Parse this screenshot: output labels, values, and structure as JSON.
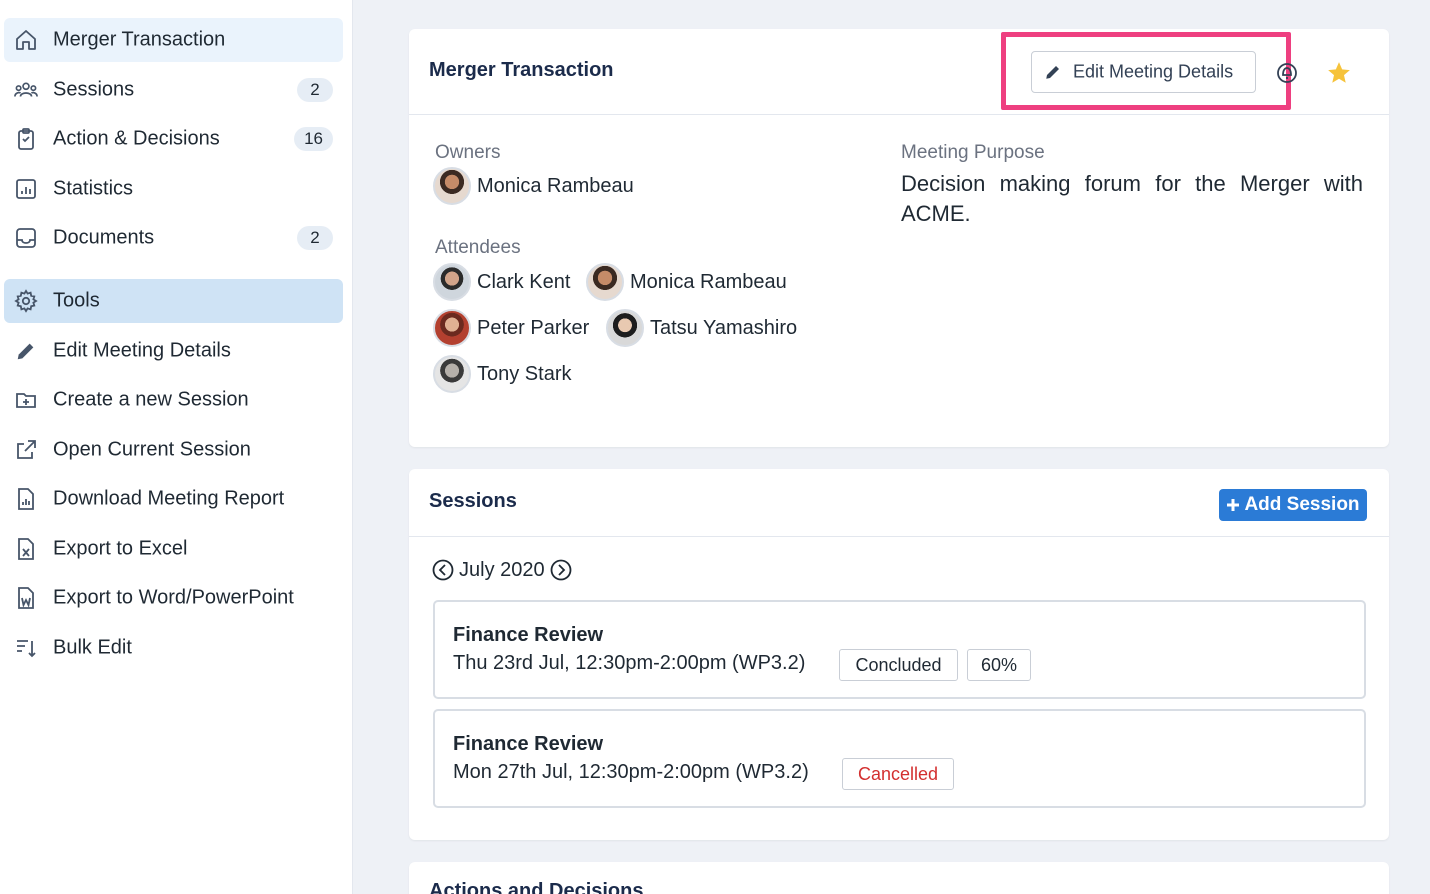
{
  "sidebar": {
    "items": [
      {
        "label": "Merger Transaction",
        "icon": "home-icon"
      },
      {
        "label": "Sessions",
        "badge": "2",
        "icon": "people-icon"
      },
      {
        "label": "Action & Decisions",
        "badge": "16",
        "icon": "clipboard-icon"
      },
      {
        "label": "Statistics",
        "icon": "bar-chart-icon"
      },
      {
        "label": "Documents",
        "badge": "2",
        "icon": "inbox-icon"
      }
    ],
    "tools_label": "Tools",
    "tools": [
      {
        "label": "Edit Meeting Details",
        "icon": "pencil-icon"
      },
      {
        "label": "Create a new Session",
        "icon": "folder-plus-icon"
      },
      {
        "label": "Open Current Session",
        "icon": "external-link-icon"
      },
      {
        "label": "Download Meeting Report",
        "icon": "report-icon"
      },
      {
        "label": "Export to Excel",
        "icon": "excel-file-icon"
      },
      {
        "label": "Export to Word/PowerPoint",
        "icon": "word-file-icon"
      },
      {
        "label": "Bulk Edit",
        "icon": "sort-list-icon"
      }
    ]
  },
  "meeting": {
    "title": "Merger Transaction",
    "edit_button": "Edit Meeting Details",
    "owners_label": "Owners",
    "owners": [
      "Monica Rambeau"
    ],
    "attendees_label": "Attendees",
    "attendees": [
      "Clark Kent",
      "Monica Rambeau",
      "Peter Parker",
      "Tatsu Yamashiro",
      "Tony Stark"
    ],
    "purpose_label": "Meeting Purpose",
    "purpose": "Decision making forum for the Merger with ACME."
  },
  "sessions": {
    "title": "Sessions",
    "add_button": "Add Session",
    "month": "July 2020",
    "list": [
      {
        "title": "Finance Review",
        "time": "Thu 23rd Jul, 12:30pm-2:00pm (WP3.2)",
        "status": "Concluded",
        "progress": "60%"
      },
      {
        "title": "Finance Review",
        "time": "Mon 27th Jul, 12:30pm-2:00pm (WP3.2)",
        "status": "Cancelled"
      }
    ]
  },
  "actions_card": {
    "title": "Actions and Decisions"
  },
  "colors": {
    "highlight": "#ee3f80",
    "accent": "#2b7bd6",
    "cancelled": "#d32f2f",
    "star": "#f6c33b"
  }
}
